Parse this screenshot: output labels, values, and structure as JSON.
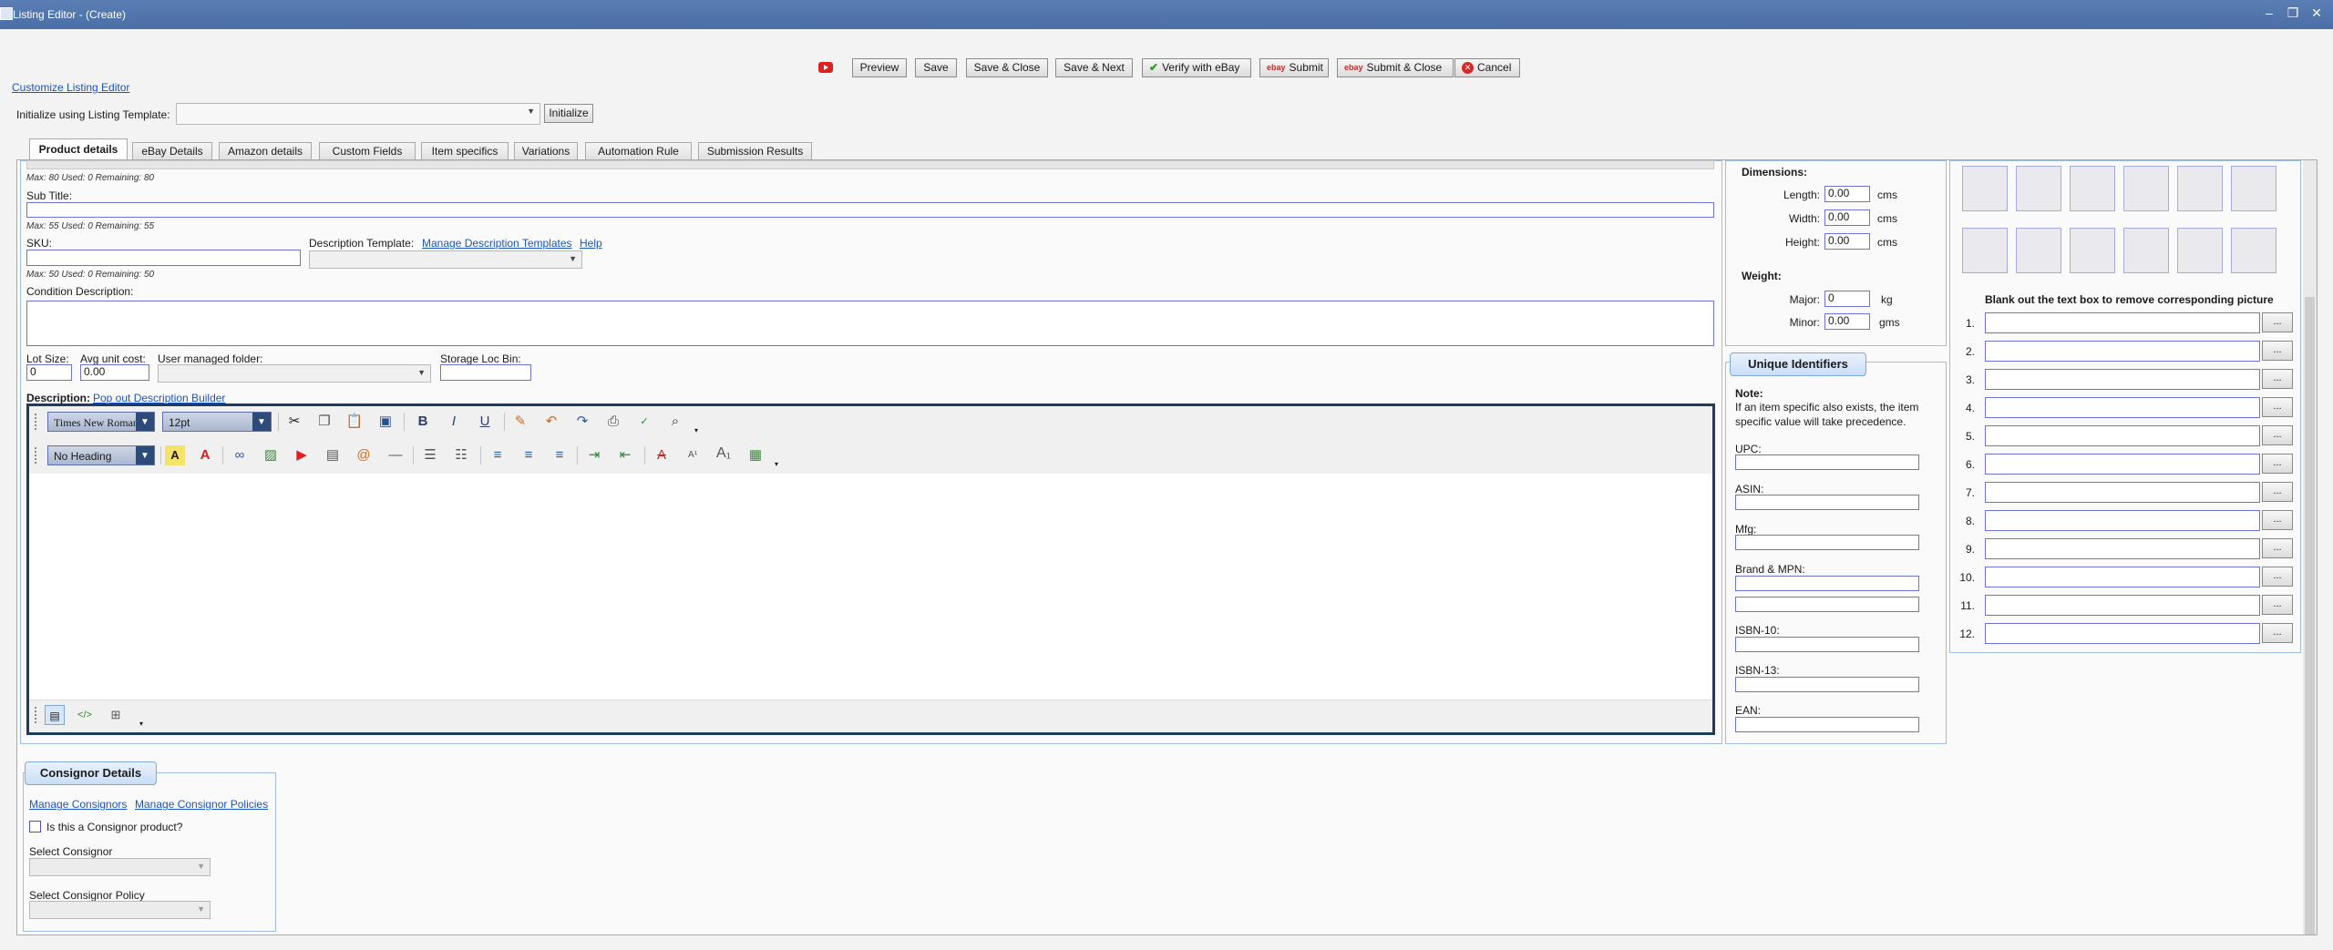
{
  "window": {
    "title": "Listing Editor - (Create)",
    "minimize": "–",
    "restore": "❐",
    "close": "✕"
  },
  "toolbar": {
    "preview": "Preview",
    "save": "Save",
    "save_close": "Save & Close",
    "save_next": "Save & Next",
    "verify": "Verify with eBay",
    "submit": "Submit",
    "submit_close": "Submit & Close",
    "cancel": "Cancel"
  },
  "customize_link": "Customize Listing Editor",
  "init": {
    "label": "Initialize using Listing Template:",
    "button": "Initialize"
  },
  "tabs": [
    "Product details",
    "eBay Details",
    "Amazon details",
    "Custom Fields",
    "Item specifics",
    "Variations",
    "Automation Rule",
    "Submission Results"
  ],
  "product": {
    "title_counter": "Max: 80 Used: 0 Remaining: 80",
    "subtitle_label": "Sub Title:",
    "subtitle_counter": "Max: 55 Used: 0 Remaining: 55",
    "sku_label": "SKU:",
    "sku_counter": "Max: 50 Used: 0 Remaining: 50",
    "desc_template_label": "Description Template:",
    "manage_templates": "Manage Description Templates",
    "help": "Help",
    "condition_label": "Condition Description:",
    "lot_label": "Lot Size:",
    "lot_value": "0",
    "avg_label": "Avg unit cost:",
    "avg_value": "0.00",
    "folder_label": "User managed folder:",
    "bin_label": "Storage Loc Bin:",
    "description_label": "Description:",
    "popout": "Pop out Description Builder"
  },
  "editor": {
    "font": "Times New Roman",
    "size": "12pt",
    "heading": "No Heading"
  },
  "dimensions": {
    "heading": "Dimensions:",
    "length": {
      "label": "Length:",
      "value": "0.00",
      "unit": "cms"
    },
    "width": {
      "label": "Width:",
      "value": "0.00",
      "unit": "cms"
    },
    "height": {
      "label": "Height:",
      "value": "0.00",
      "unit": "cms"
    },
    "weight_heading": "Weight:",
    "major": {
      "label": "Major:",
      "value": "0",
      "unit": "kg"
    },
    "minor": {
      "label": "Minor:",
      "value": "0.00",
      "unit": "gms"
    }
  },
  "uid": {
    "heading": "Unique Identifiers",
    "note_title": "Note:",
    "note_text": "If an item specific also exists, the item specific value will take precedence.",
    "upc": "UPC:",
    "asin": "ASIN:",
    "mfg": "Mfg:",
    "brand_mpn": "Brand & MPN:",
    "isbn10": "ISBN-10:",
    "isbn13": "ISBN-13:",
    "ean": "EAN:"
  },
  "pictures": {
    "hint": "Blank out the text box to remove corresponding picture",
    "numbers": [
      "1.",
      "2.",
      "3.",
      "4.",
      "5.",
      "6.",
      "7.",
      "8.",
      "9.",
      "10.",
      "11.",
      "12."
    ],
    "browse": "..."
  },
  "consignor": {
    "heading": "Consignor Details",
    "manage": "Manage Consignors",
    "policies": "Manage Consignor Policies",
    "is_consignor": "Is this a Consignor product?",
    "select_consignor": "Select Consignor",
    "select_policy": "Select Consignor Policy"
  },
  "colors": {
    "title_bar": "#4f74ab",
    "group_border": "#9dbde6",
    "textbox_border": "#6b73d9"
  }
}
